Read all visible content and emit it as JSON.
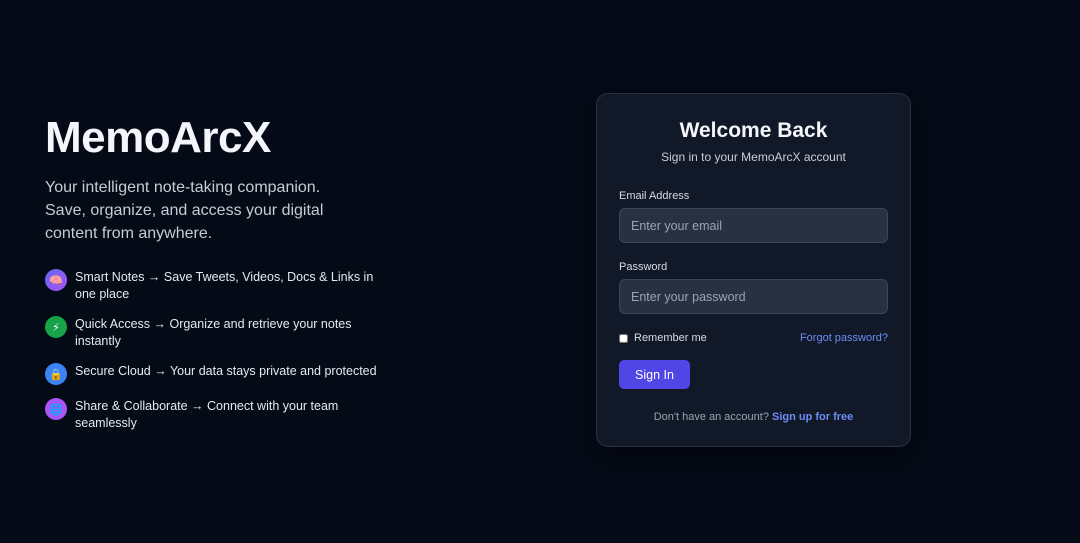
{
  "hero": {
    "brand": "MemoArcX",
    "tagline": "Your intelligent note-taking companion. Save, organize, and access your digital content from anywhere.",
    "features": [
      {
        "icon": "brain-icon",
        "icon_glyph": "🧠",
        "color": "#7c4dff",
        "text": "Smart Notes → Save Tweets, Videos, Docs & Links in one place"
      },
      {
        "icon": "lightning-icon",
        "icon_glyph": "⚡",
        "color": "#16a34a",
        "text": "Quick Access → Organize and retrieve your notes instantly"
      },
      {
        "icon": "lock-icon",
        "icon_glyph": "🔒",
        "color": "#3b82f6",
        "text": "Secure Cloud → Your data stays private and protected"
      },
      {
        "icon": "globe-icon",
        "icon_glyph": "🌐",
        "color": "#a855f7",
        "text": "Share & Collaborate → Connect with your team seamlessly"
      }
    ]
  },
  "login": {
    "title": "Welcome Back",
    "subtitle": "Sign in to your MemoArcX account",
    "email_label": "Email Address",
    "email_placeholder": "Enter your email",
    "password_label": "Password",
    "password_placeholder": "Enter your password",
    "remember_label": "Remember me",
    "forgot_label": "Forgot password?",
    "signin_label": "Sign In",
    "signup_prompt": "Don't have an account?",
    "signup_link": "Sign up for free"
  },
  "colors": {
    "background": "#050a17",
    "card": "#111827",
    "accent": "#4f46e5",
    "link": "#6d8cf6"
  }
}
